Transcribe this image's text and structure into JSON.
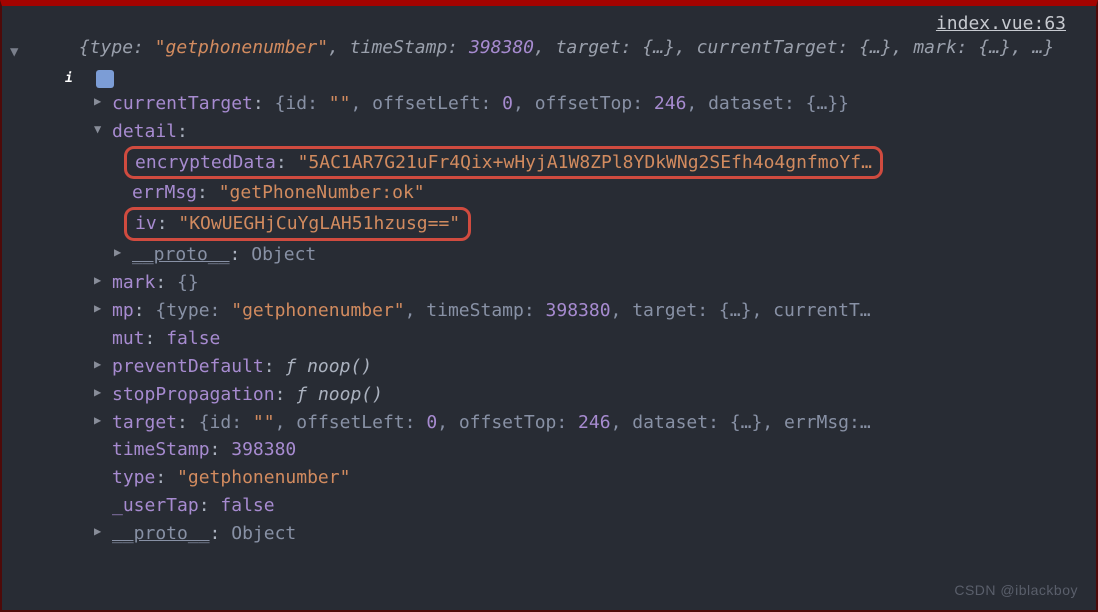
{
  "source": "index.vue:63",
  "summary": {
    "prefix": "{type: ",
    "type": "\"getphonenumber\"",
    "mid1": ", timeStamp: ",
    "timeStamp": "398380",
    "mid2": ", target: ",
    "target": "{…}",
    "mid3": ", currentTarget: ",
    "currentTarget": "{…}",
    "mid4": ", mark: ",
    "mark": "{…}",
    "suffix": ", …}"
  },
  "currentTarget": {
    "key": "currentTarget",
    "open": "{id: ",
    "id": "\"\"",
    "p1": ", offsetLeft: ",
    "offsetLeft": "0",
    "p2": ", offsetTop: ",
    "offsetTop": "246",
    "p3": ", dataset: ",
    "dataset": "{…}",
    "close": "}"
  },
  "detail": {
    "key": "detail",
    "encryptedData": {
      "key": "encryptedData",
      "value": "\"5AC1AR7G21uFr4Qix+wHyjA1W8ZPl8YDkWNg2SEfh4o4gnfmoYf…"
    },
    "errMsg": {
      "key": "errMsg",
      "value": "\"getPhoneNumber:ok\""
    },
    "iv": {
      "key": "iv",
      "value": "\"KOwUEGHjCuYgLAH51hzusg==\""
    },
    "proto": {
      "key": "__proto__",
      "value": "Object"
    }
  },
  "mark": {
    "key": "mark",
    "value": "{}"
  },
  "mp": {
    "key": "mp",
    "open": "{type: ",
    "type": "\"getphonenumber\"",
    "p1": ", timeStamp: ",
    "timeStamp": "398380",
    "p2": ", target: ",
    "target": "{…}",
    "suffix": ", currentT…"
  },
  "mut": {
    "key": "mut",
    "value": "false"
  },
  "preventDefault": {
    "key": "preventDefault",
    "f": "ƒ",
    "name": "noop()"
  },
  "stopPropagation": {
    "key": "stopPropagation",
    "f": "ƒ",
    "name": "noop()"
  },
  "target": {
    "key": "target",
    "open": "{id: ",
    "id": "\"\"",
    "p1": ", offsetLeft: ",
    "offsetLeft": "0",
    "p2": ", offsetTop: ",
    "offsetTop": "246",
    "p3": ", dataset: ",
    "dataset": "{…}",
    "suffix": ", errMsg:…"
  },
  "timeStampRow": {
    "key": "timeStamp",
    "value": "398380"
  },
  "typeRow": {
    "key": "type",
    "value": "\"getphonenumber\""
  },
  "userTap": {
    "key": "_userTap",
    "value": "false"
  },
  "proto": {
    "key": "__proto__",
    "value": "Object"
  },
  "watermark": "CSDN @iblackboy"
}
